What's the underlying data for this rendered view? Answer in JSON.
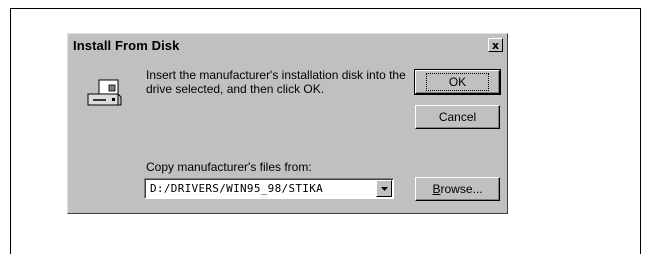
{
  "dialog": {
    "title": "Install From Disk",
    "close_glyph": "x",
    "message": "Insert the manufacturer's installation disk into the drive selected, and then click OK.",
    "ok_label": "OK",
    "cancel_label": "Cancel",
    "copy_label": "Copy manufacturer's files from:",
    "path_value": "D:/DRIVERS/WIN95_98/STIKA",
    "browse_label": "Browse..."
  },
  "icons": {
    "disk": "disk-drive-icon",
    "close": "close-icon",
    "dropdown": "chevron-down-icon"
  },
  "colors": {
    "face": "#c0c0c0",
    "shadow": "#808080",
    "highlight": "#ffffff",
    "text": "#000000"
  }
}
